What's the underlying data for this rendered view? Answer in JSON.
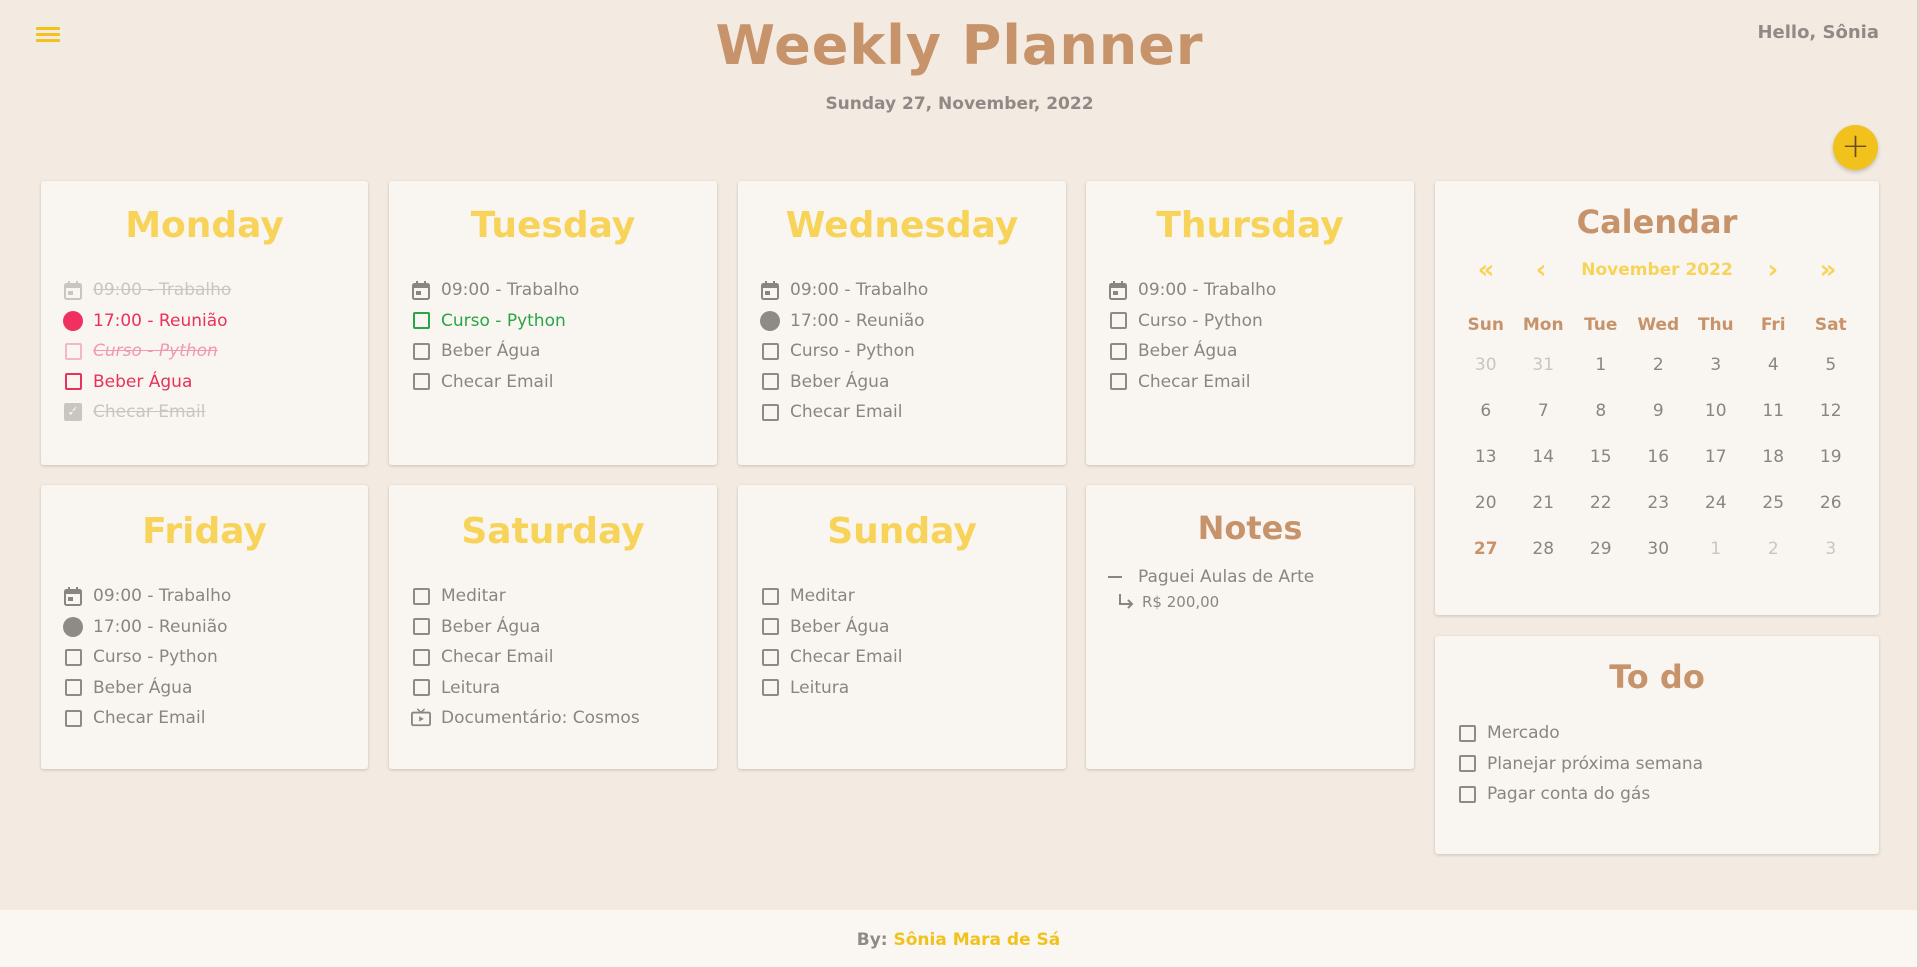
{
  "header": {
    "title": "Weekly Planner",
    "date": "Sunday 27, November, 2022",
    "greeting": "Hello, Sônia",
    "add_label": "+"
  },
  "colors": {
    "accent": "#f1c21b",
    "brown": "#c7936b",
    "day_title": "#f7d35a",
    "red": "#e8315b",
    "green": "#2aa545",
    "background": "#f3ebe1"
  },
  "days": [
    {
      "name": "Monday",
      "tasks": [
        {
          "label": "09:00 - Trabalho",
          "icon": "calendar-icon",
          "state": "done"
        },
        {
          "label": "17:00 - Reunião",
          "icon": "dot-icon",
          "state": "red"
        },
        {
          "label": "Curso - Python",
          "icon": "checkbox-icon",
          "state": "redfaded"
        },
        {
          "label": "Beber Água",
          "icon": "checkbox-icon",
          "state": "red"
        },
        {
          "label": "Checar Email",
          "icon": "checked-icon",
          "state": "done"
        }
      ]
    },
    {
      "name": "Tuesday",
      "tasks": [
        {
          "label": "09:00 - Trabalho",
          "icon": "calendar-icon",
          "state": ""
        },
        {
          "label": "Curso - Python",
          "icon": "checkbox-icon",
          "state": "green"
        },
        {
          "label": "Beber Água",
          "icon": "checkbox-icon",
          "state": ""
        },
        {
          "label": "Checar Email",
          "icon": "checkbox-icon",
          "state": ""
        }
      ]
    },
    {
      "name": "Wednesday",
      "tasks": [
        {
          "label": "09:00 - Trabalho",
          "icon": "calendar-icon",
          "state": ""
        },
        {
          "label": "17:00 - Reunião",
          "icon": "dot-icon",
          "state": ""
        },
        {
          "label": "Curso - Python",
          "icon": "checkbox-icon",
          "state": ""
        },
        {
          "label": "Beber Água",
          "icon": "checkbox-icon",
          "state": ""
        },
        {
          "label": "Checar Email",
          "icon": "checkbox-icon",
          "state": ""
        }
      ]
    },
    {
      "name": "Thursday",
      "tasks": [
        {
          "label": "09:00 - Trabalho",
          "icon": "calendar-icon",
          "state": ""
        },
        {
          "label": "Curso - Python",
          "icon": "checkbox-icon",
          "state": ""
        },
        {
          "label": "Beber Água",
          "icon": "checkbox-icon",
          "state": ""
        },
        {
          "label": "Checar Email",
          "icon": "checkbox-icon",
          "state": ""
        }
      ]
    },
    {
      "name": "Friday",
      "tasks": [
        {
          "label": "09:00 - Trabalho",
          "icon": "calendar-icon",
          "state": ""
        },
        {
          "label": "17:00 - Reunião",
          "icon": "dot-icon",
          "state": ""
        },
        {
          "label": "Curso - Python",
          "icon": "checkbox-icon",
          "state": ""
        },
        {
          "label": "Beber Água",
          "icon": "checkbox-icon",
          "state": ""
        },
        {
          "label": "Checar Email",
          "icon": "checkbox-icon",
          "state": ""
        }
      ]
    },
    {
      "name": "Saturday",
      "tasks": [
        {
          "label": "Meditar",
          "icon": "checkbox-icon",
          "state": ""
        },
        {
          "label": "Beber Água",
          "icon": "checkbox-icon",
          "state": ""
        },
        {
          "label": "Checar Email",
          "icon": "checkbox-icon",
          "state": ""
        },
        {
          "label": "Leitura",
          "icon": "checkbox-icon",
          "state": ""
        },
        {
          "label": "Documentário: Cosmos",
          "icon": "tv-icon",
          "state": ""
        }
      ]
    },
    {
      "name": "Sunday",
      "tasks": [
        {
          "label": "Meditar",
          "icon": "checkbox-icon",
          "state": ""
        },
        {
          "label": "Beber Água",
          "icon": "checkbox-icon",
          "state": ""
        },
        {
          "label": "Checar Email",
          "icon": "checkbox-icon",
          "state": ""
        },
        {
          "label": "Leitura",
          "icon": "checkbox-icon",
          "state": ""
        }
      ]
    }
  ],
  "notes": {
    "title": "Notes",
    "item": "Paguei Aulas de Arte",
    "sub": "R$ 200,00"
  },
  "calendar": {
    "title": "Calendar",
    "month": "November 2022",
    "nav": {
      "first": "«",
      "prev": "‹",
      "next": "›",
      "last": "»"
    },
    "weekdays": [
      "Sun",
      "Mon",
      "Tue",
      "Wed",
      "Thu",
      "Fri",
      "Sat"
    ],
    "days": [
      {
        "d": "30",
        "t": "other"
      },
      {
        "d": "31",
        "t": "other"
      },
      {
        "d": "1",
        "t": ""
      },
      {
        "d": "2",
        "t": ""
      },
      {
        "d": "3",
        "t": ""
      },
      {
        "d": "4",
        "t": ""
      },
      {
        "d": "5",
        "t": ""
      },
      {
        "d": "6",
        "t": ""
      },
      {
        "d": "7",
        "t": ""
      },
      {
        "d": "8",
        "t": ""
      },
      {
        "d": "9",
        "t": ""
      },
      {
        "d": "10",
        "t": ""
      },
      {
        "d": "11",
        "t": ""
      },
      {
        "d": "12",
        "t": ""
      },
      {
        "d": "13",
        "t": ""
      },
      {
        "d": "14",
        "t": ""
      },
      {
        "d": "15",
        "t": ""
      },
      {
        "d": "16",
        "t": ""
      },
      {
        "d": "17",
        "t": ""
      },
      {
        "d": "18",
        "t": ""
      },
      {
        "d": "19",
        "t": ""
      },
      {
        "d": "20",
        "t": ""
      },
      {
        "d": "21",
        "t": ""
      },
      {
        "d": "22",
        "t": ""
      },
      {
        "d": "23",
        "t": ""
      },
      {
        "d": "24",
        "t": ""
      },
      {
        "d": "25",
        "t": ""
      },
      {
        "d": "26",
        "t": ""
      },
      {
        "d": "27",
        "t": "today"
      },
      {
        "d": "28",
        "t": ""
      },
      {
        "d": "29",
        "t": ""
      },
      {
        "d": "30",
        "t": ""
      },
      {
        "d": "1",
        "t": "other"
      },
      {
        "d": "2",
        "t": "other"
      },
      {
        "d": "3",
        "t": "other"
      }
    ]
  },
  "todo": {
    "title": "To do",
    "items": [
      "Mercado",
      "Planejar próxima semana",
      "Pagar conta do gás"
    ]
  },
  "footer": {
    "prefix": "By:",
    "author": "Sônia Mara de Sá"
  }
}
